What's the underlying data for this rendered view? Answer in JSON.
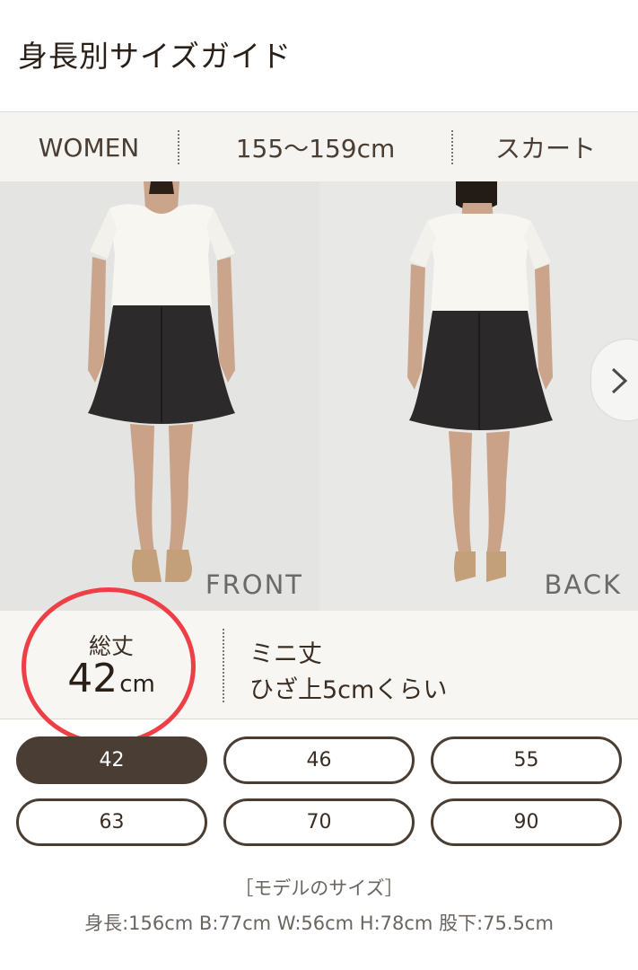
{
  "page": {
    "title": "身長別サイズガイド"
  },
  "filters": {
    "gender": "WOMEN",
    "height_range": "155〜159cm",
    "category": "スカート"
  },
  "photos": {
    "front_label": "FRONT",
    "back_label": "BACK",
    "next_icon": "chevron-right-icon"
  },
  "length_info": {
    "label": "総丈",
    "value": "42",
    "unit": "cm",
    "type": "ミニ丈",
    "note": "ひざ上5cmくらい"
  },
  "sizes": [
    {
      "label": "42",
      "selected": true
    },
    {
      "label": "46",
      "selected": false
    },
    {
      "label": "55",
      "selected": false
    },
    {
      "label": "63",
      "selected": false
    },
    {
      "label": "70",
      "selected": false
    },
    {
      "label": "90",
      "selected": false
    }
  ],
  "model": {
    "heading": "［モデルのサイズ］",
    "stats": "身長:156cm B:77cm W:56cm H:78cm 股下:75.5cm"
  },
  "colors": {
    "accent": "#4a3d33",
    "highlight_ring": "#ee3f47"
  }
}
